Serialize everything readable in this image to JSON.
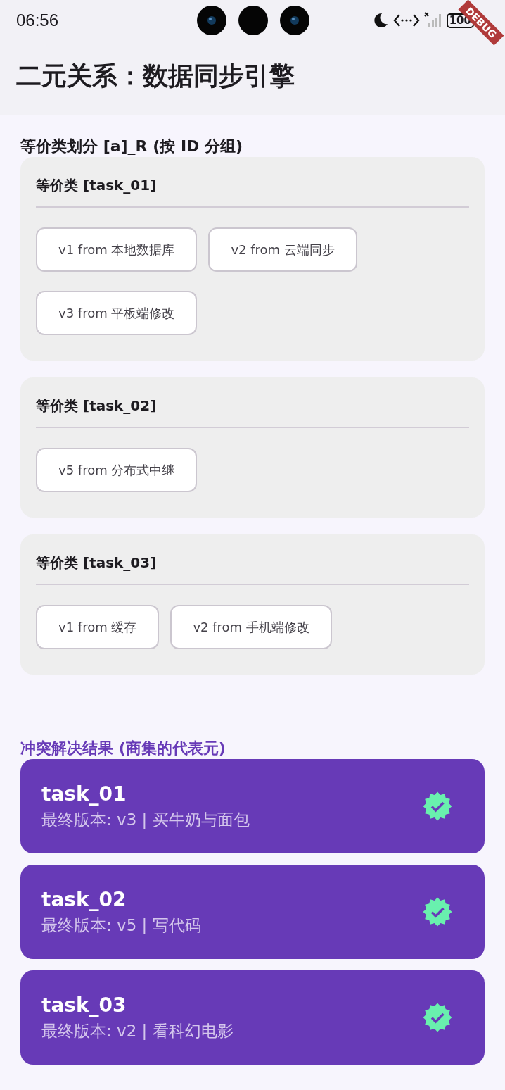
{
  "status_bar": {
    "time": "06:56",
    "battery": "100"
  },
  "debug_banner": "DEBUG",
  "app_bar": {
    "title": "二元关系：数据同步引擎"
  },
  "partition": {
    "title": "等价类划分 [a]_R (按 ID 分组)",
    "groups": [
      {
        "title": "等价类 [task_01]",
        "items": [
          "v1 from 本地数据库",
          "v2 from 云端同步",
          "v3 from 平板端修改"
        ]
      },
      {
        "title": "等价类 [task_02]",
        "items": [
          "v5 from 分布式中继"
        ]
      },
      {
        "title": "等价类 [task_03]",
        "items": [
          "v1 from 缓存",
          "v2 from 手机端修改"
        ]
      }
    ]
  },
  "results": {
    "title": "冲突解决结果 (商集的代表元)",
    "items": [
      {
        "title": "task_01",
        "subtitle": "最终版本: v3 | 买牛奶与面包",
        "verified": true
      },
      {
        "title": "task_02",
        "subtitle": "最终版本: v5 | 写代码",
        "verified": true
      },
      {
        "title": "task_03",
        "subtitle": "最终版本: v2 | 看科幻电影",
        "verified": true
      }
    ]
  }
}
